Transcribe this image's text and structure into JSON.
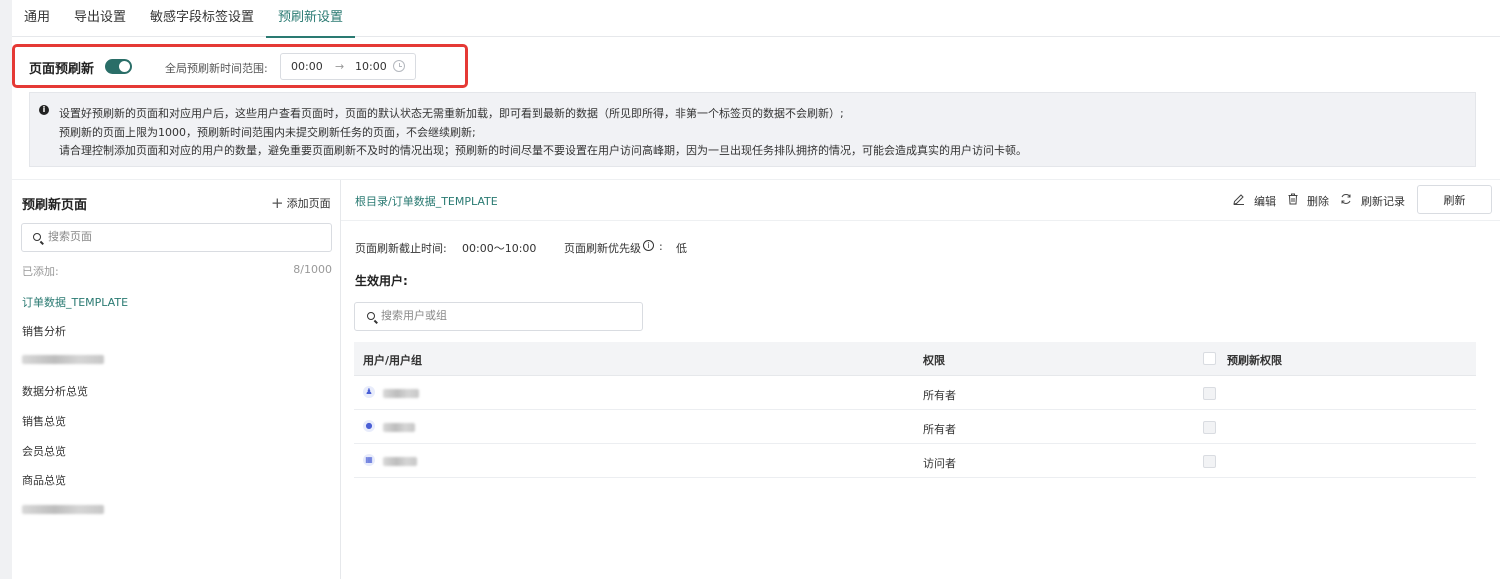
{
  "tabs": [
    {
      "label": "通用"
    },
    {
      "label": "导出设置"
    },
    {
      "label": "敏感字段标签设置"
    },
    {
      "label": "预刷新设置"
    }
  ],
  "prefresh": {
    "label": "页面预刷新",
    "enabled": true,
    "range_label": "全局预刷新时间范围:",
    "start_time": "00:00",
    "arrow": "→",
    "end_time": "10:00"
  },
  "notice": {
    "lines": [
      "设置好预刷新的页面和对应用户后，这些用户查看页面时，页面的默认状态无需重新加载，即可看到最新的数据（所见即所得，非第一个标签页的数据不会刷新）;",
      "预刷新的页面上限为1000，预刷新时间范围内未提交刷新任务的页面，不会继续刷新;",
      "请合理控制添加页面和对应的用户的数量，避免重要页面刷新不及时的情况出现；预刷新的时间尽量不要设置在用户访问高峰期，因为一旦出现任务排队拥挤的情况，可能会造成真实的用户访问卡顿。"
    ]
  },
  "left_panel": {
    "title": "预刷新页面",
    "add_label": "添加页面",
    "search_placeholder": "搜索页面",
    "added_label": "已添加:",
    "added_count": "8/1000",
    "pages": [
      {
        "label": "订单数据_TEMPLATE",
        "active": true
      },
      {
        "label": "销售分析"
      },
      {
        "label": ""
      },
      {
        "label": "数据分析总览"
      },
      {
        "label": "销售总览"
      },
      {
        "label": "会员总览"
      },
      {
        "label": "商品总览"
      },
      {
        "label": ""
      }
    ]
  },
  "detail": {
    "breadcrumb": "根目录/订单数据_TEMPLATE",
    "actions": {
      "edit": "编辑",
      "delete": "删除",
      "history": "刷新记录",
      "refresh": "刷新"
    },
    "deadline_label": "页面刷新截止时间:",
    "deadline_value": "00:00〜10:00",
    "priority_label": "页面刷新优先级",
    "priority_value": "低",
    "users_title": "生效用户:",
    "user_search_placeholder": "搜索用户或组",
    "table": {
      "columns": [
        "用户/用户组",
        "权限",
        "预刷新权限"
      ],
      "rows": [
        {
          "permission": "所有者",
          "icon": "group-icon"
        },
        {
          "permission": "所有者",
          "icon": "user-icon"
        },
        {
          "permission": "访问者",
          "icon": "org-icon"
        }
      ]
    }
  },
  "colors": {
    "accent": "#2a7a72",
    "highlight_frame": "#e53935"
  }
}
